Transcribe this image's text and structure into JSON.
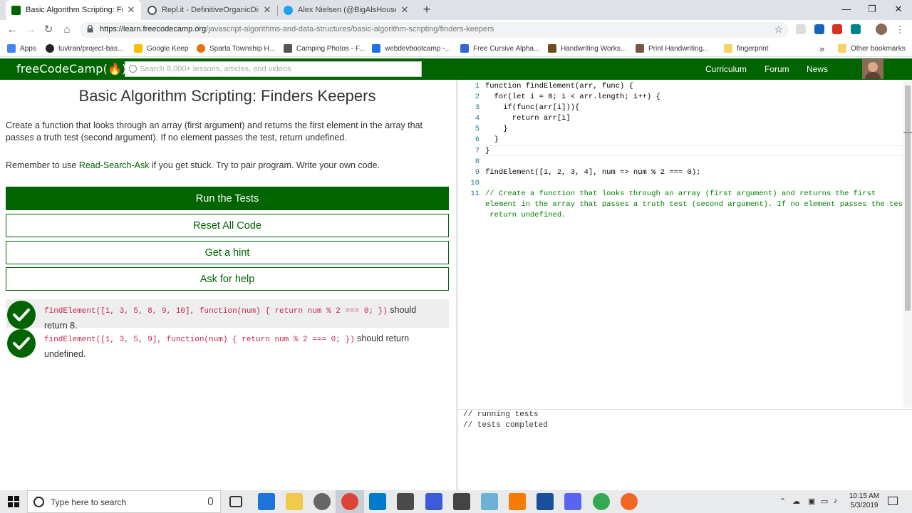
{
  "browser": {
    "tabs": [
      {
        "title": "Basic Algorithm Scripting: Finde",
        "close": "✕",
        "favicon_color": "#006400"
      },
      {
        "title": "Repl.it - DefinitiveOrganicDiction",
        "close": "✕",
        "favicon_color": "#555555"
      },
      {
        "title": "Alex Nielsen (@BigAlsHouse) | Tw",
        "close": "✕",
        "favicon_color": "#1da1f2"
      }
    ],
    "new_tab": "+",
    "window_controls": {
      "minimize": "—",
      "maximize": "❐",
      "close": "✕"
    },
    "nav": {
      "back": "←",
      "forward": "→",
      "reload": "↻",
      "home": "⌂"
    },
    "address": {
      "url_host": "https://learn.freecodecamp.org",
      "url_path": "/javascript-algorithms-and-data-structures/basic-algorithm-scripting/finders-keepers"
    },
    "bookmarks": [
      {
        "label": "Apps",
        "color": "#4285f4"
      },
      {
        "label": "tuvtran/project-bas...",
        "color": "#222222"
      },
      {
        "label": "Google Keep",
        "color": "#fbbc04"
      },
      {
        "label": "Sparta Township H...",
        "color": "#e8710a"
      },
      {
        "label": "Camping Photos - F...",
        "color": "#555555"
      },
      {
        "label": "webdevbootcamp -...",
        "color": "#1a73e8"
      },
      {
        "label": "Free Cursive Alpha...",
        "color": "#3367d6"
      },
      {
        "label": "Handwriting Works...",
        "color": "#6d4c1f"
      },
      {
        "label": "Print Handwriting...",
        "color": "#795548"
      },
      {
        "label": "fingerprint",
        "color": "#f6d365"
      }
    ],
    "bookmarks_more": "»",
    "other_bookmarks": "Other bookmarks"
  },
  "fcc": {
    "logo": "freeCodeCamp(🔥)",
    "search_placeholder": "Search 8,000+ lessons, articles, and videos",
    "nav_links": [
      "Curriculum",
      "Forum",
      "News"
    ],
    "brand_color": "#006400"
  },
  "challenge": {
    "title": "Basic Algorithm Scripting: Finders Keepers",
    "description": "Create a function that looks through an array (first argument) and returns the first element in the array that passes a truth test (second argument). If no element passes the test, return undefined.",
    "remind_prefix": "Remember to use ",
    "remind_link": "Read-Search-Ask",
    "remind_suffix": " if you get stuck. Try to pair program. Write your own code.",
    "buttons": {
      "run": "Run the Tests",
      "reset": "Reset All Code",
      "hint": "Get a hint",
      "help": "Ask for help"
    },
    "tests": [
      {
        "code": "findElement([1, 3, 5, 8, 9, 10], function(num) { return num % 2 === 0; })",
        "text_a": " should",
        "text_b": "return 8.",
        "passed": true
      },
      {
        "code": "findElement([1, 3, 5, 9], function(num) { return num % 2 === 0; })",
        "text_a": " should return",
        "text_b": "undefined.",
        "passed": true
      }
    ]
  },
  "editor": {
    "line_numbers": [
      "1",
      "2",
      "3",
      "4",
      "5",
      "6",
      "7",
      "8",
      "9",
      "10",
      "11"
    ],
    "lines": [
      "function findElement(arr, func) {",
      "  for(let i = 0; i < arr.length; i++) {",
      "    if(func(arr[i])){",
      "      return arr[i]",
      "    }",
      "  }",
      "}",
      "",
      "findElement([1, 2, 3, 4], num => num % 2 === 0);",
      "",
      "// Create a function that looks through an array (first argument) and returns the first",
      "element in the array that passes a truth test (second argument). If no element passes the test,",
      " return undefined."
    ]
  },
  "console": {
    "lines": [
      "// running tests",
      "// tests completed"
    ]
  },
  "taskbar": {
    "search_text": "Type here to search",
    "time": "10:15 AM",
    "date": "5/3/2019"
  }
}
